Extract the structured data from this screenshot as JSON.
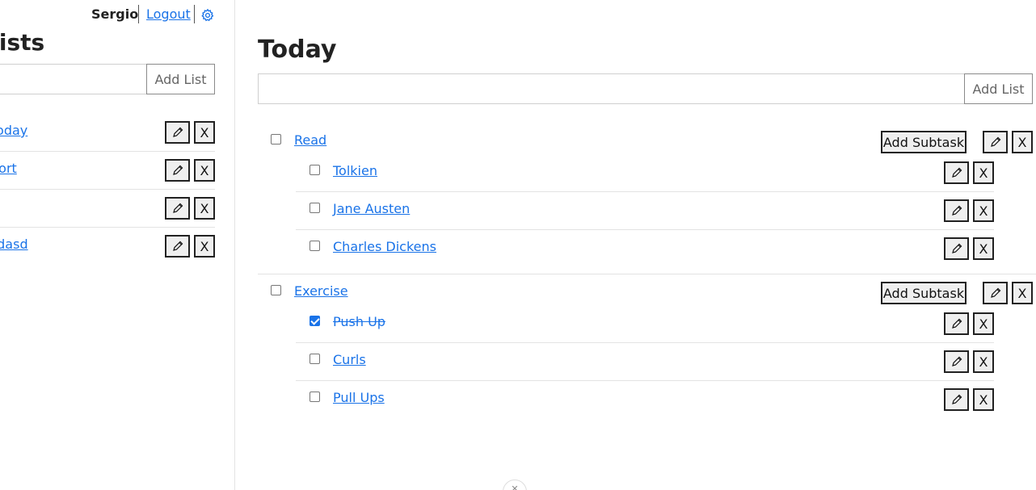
{
  "header": {
    "user_name": "Sergio",
    "logout_label": "Logout",
    "settings_icon": "gear-icon"
  },
  "sidebar": {
    "title": "Lists",
    "new_list_placeholder": "",
    "add_list_label": "Add List",
    "items": [
      {
        "label": "Today"
      },
      {
        "label": "Sort"
      },
      {
        "label": ""
      },
      {
        "label": "asdasd"
      }
    ],
    "edit_icon": "pencil-icon",
    "delete_label": "X"
  },
  "main": {
    "title": "Today",
    "new_task_placeholder": "",
    "add_list_label": "Add List",
    "add_subtask_label": "Add Subtask",
    "delete_label": "X",
    "accent_color": "#1a73e8",
    "groups": [
      {
        "label": "Read",
        "checked": false,
        "subtasks": [
          {
            "label": "Tolkien",
            "checked": false
          },
          {
            "label": "Jane Austen",
            "checked": false
          },
          {
            "label": "Charles Dickens",
            "checked": false
          }
        ]
      },
      {
        "label": "Exercise",
        "checked": false,
        "subtasks": [
          {
            "label": "Push Up",
            "checked": true
          },
          {
            "label": "Curls",
            "checked": false
          },
          {
            "label": "Pull Ups",
            "checked": false
          }
        ]
      }
    ]
  }
}
